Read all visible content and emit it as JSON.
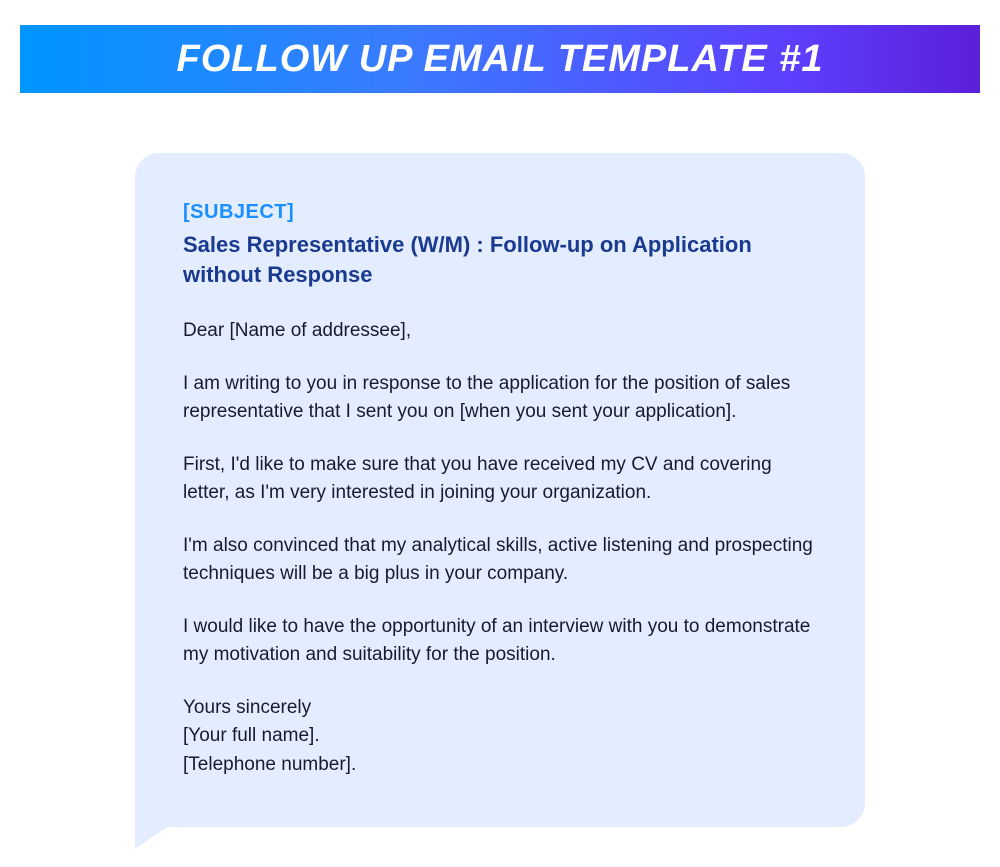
{
  "header": {
    "title": "FOLLOW UP EMAIL TEMPLATE #1"
  },
  "email": {
    "subject_label": "[SUBJECT]",
    "subject": "Sales Representative (W/M) : Follow-up on Application without Response",
    "greeting": "Dear [Name of addressee],",
    "paragraphs": [
      "I am writing to you in response to the application for the position of sales representative that I sent you on [when you sent your application].",
      "First, I'd like to make sure that you have received my CV and covering letter, as I'm very interested in joining your organization.",
      "I'm also convinced that my analytical skills, active listening and prospecting techniques will be a big plus in your company.",
      "I would like to have the opportunity of an interview with you to demonstrate my motivation and suitability for the position."
    ],
    "closing": "Yours sincerely",
    "signature_name": "[Your full name].",
    "signature_phone": "[Telephone number]."
  }
}
